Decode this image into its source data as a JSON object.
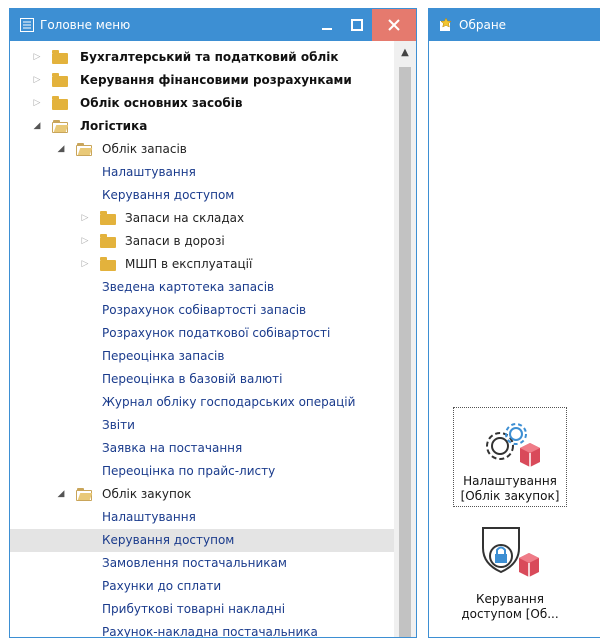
{
  "colors": {
    "titlebar": "#3d8fd3",
    "close": "#e57a6e",
    "link": "#1a3b8c",
    "selected_row": "#e4e4e4",
    "folder": "#e3b23c"
  },
  "left_window": {
    "title": "Головне меню",
    "buttons": {
      "minimize": "_",
      "maximize": "☐",
      "close": "✕"
    },
    "scroll_up_glyph": "▲"
  },
  "tree": [
    {
      "label": "Бухгалтерський та податковий облік",
      "style": "bold",
      "expander": "collapsed",
      "folder": "closed",
      "level": 0
    },
    {
      "label": "Керування фінансовими розрахунками",
      "style": "bold",
      "expander": "collapsed",
      "folder": "closed",
      "level": 0
    },
    {
      "label": "Облік основних засобів",
      "style": "bold",
      "expander": "collapsed",
      "folder": "closed",
      "level": 0
    },
    {
      "label": "Логістика",
      "style": "bold",
      "expander": "expanded",
      "folder": "open",
      "level": 0
    },
    {
      "label": "Облік запасів",
      "style": "dark",
      "expander": "expanded",
      "folder": "open",
      "level": 1
    },
    {
      "label": "Налаштування",
      "style": "link",
      "level": 2
    },
    {
      "label": "Керування доступом",
      "style": "link",
      "level": 2
    },
    {
      "label": "Запаси на складах",
      "style": "dark",
      "expander": "collapsed",
      "folder": "closed",
      "level": 2
    },
    {
      "label": "Запаси в дорозі",
      "style": "dark",
      "expander": "collapsed",
      "folder": "closed",
      "level": 2
    },
    {
      "label": "МШП в експлуатації",
      "style": "dark",
      "expander": "collapsed",
      "folder": "closed",
      "level": 2
    },
    {
      "label": "Зведена картотека запасів",
      "style": "link",
      "level": 2
    },
    {
      "label": "Розрахунок собівартості запасів",
      "style": "link",
      "level": 2
    },
    {
      "label": "Розрахунок податкової собівартості",
      "style": "link",
      "level": 2
    },
    {
      "label": "Переоцінка запасів",
      "style": "link",
      "level": 2
    },
    {
      "label": "Переоцінка в базовій валюті",
      "style": "link",
      "level": 2
    },
    {
      "label": "Журнал обліку господарських операцій",
      "style": "link",
      "level": 2
    },
    {
      "label": "Звіти",
      "style": "link",
      "level": 2
    },
    {
      "label": "Заявка на постачання",
      "style": "link",
      "level": 2
    },
    {
      "label": "Переоцінка по прайс-листу",
      "style": "link",
      "level": 2
    },
    {
      "label": "Облік закупок",
      "style": "dark",
      "expander": "expanded",
      "folder": "open",
      "level": 1
    },
    {
      "label": "Налаштування",
      "style": "link",
      "level": 2
    },
    {
      "label": "Керування доступом",
      "style": "link",
      "level": 2,
      "selected": true
    },
    {
      "label": "Замовлення постачальникам",
      "style": "link",
      "level": 2
    },
    {
      "label": "Рахунки до сплати",
      "style": "link",
      "level": 2
    },
    {
      "label": "Прибуткові товарні накладні",
      "style": "link",
      "level": 2
    },
    {
      "label": "Рахунок-накладна постачальника",
      "style": "link",
      "level": 2
    }
  ],
  "right_window": {
    "title": "Обране",
    "shortcuts": [
      {
        "line1": "Налаштування",
        "line2": "[Облік закупок]",
        "icon": "gears-box-icon"
      },
      {
        "line1": "Керування",
        "line2": "доступом [Об...",
        "icon": "lock-shield-box-icon"
      }
    ]
  }
}
